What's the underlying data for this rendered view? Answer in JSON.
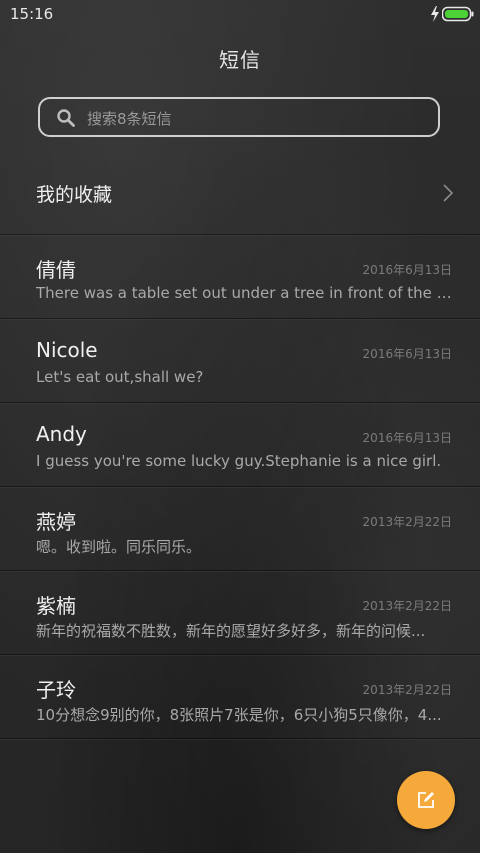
{
  "status_bar": {
    "time": "15:16",
    "battery_color": "#4cd137"
  },
  "header": {
    "title": "短信"
  },
  "search": {
    "placeholder": "搜索8条短信"
  },
  "favorites": {
    "label": "我的收藏"
  },
  "messages": [
    {
      "name": "倩倩",
      "date": "2016年6月13日",
      "preview": "There was a table set out under a tree in front of the ho..."
    },
    {
      "name": "Nicole",
      "date": "2016年6月13日",
      "preview": "Let's eat out,shall we?"
    },
    {
      "name": "Andy",
      "date": "2016年6月13日",
      "preview": "I guess you're some lucky guy.Stephanie is a nice girl."
    },
    {
      "name": "燕婷",
      "date": "2013年2月22日",
      "preview": "嗯。收到啦。同乐同乐。"
    },
    {
      "name": "紫楠",
      "date": "2013年2月22日",
      "preview": "新年的祝福数不胜数，新年的愿望好多好多，新年的问候..."
    },
    {
      "name": "子玲",
      "date": "2013年2月22日",
      "preview": "10分想念9别的你，8张照片7张是你，6只小狗5只像你，4..."
    }
  ],
  "fab": {
    "icon": "compose-icon",
    "color": "#f4a93a"
  }
}
